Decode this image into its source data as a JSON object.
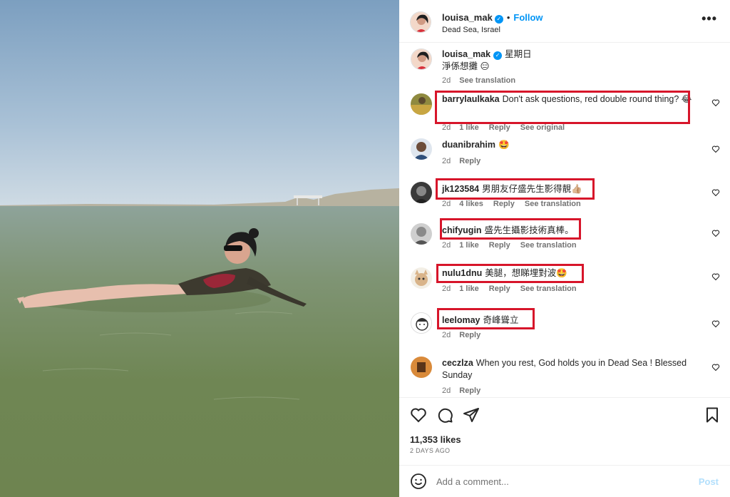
{
  "post": {
    "author": "louisa_mak",
    "follow_label": "Follow",
    "separator": "•",
    "location": "Dead Sea, Israel",
    "more_icon": "more-horizontal-icon",
    "caption": {
      "user": "louisa_mak",
      "day": "星期日",
      "text": "淨係想攤 😑",
      "time": "2d",
      "translate": "See translation"
    }
  },
  "comments": [
    {
      "user": "barrylaulkaka",
      "text": "Don't ask questions, red double round thing? 😂",
      "time": "2d",
      "likes": "1 like",
      "reply": "Reply",
      "extra": "See original",
      "highlighted": true
    },
    {
      "user": "duanibrahim",
      "text": "🤩",
      "time": "2d",
      "likes": "",
      "reply": "Reply",
      "extra": "",
      "highlighted": false
    },
    {
      "user": "jk123584",
      "text": "男朋友仔盛先生影得靚👍🏼",
      "time": "2d",
      "likes": "4 likes",
      "reply": "Reply",
      "extra": "See translation",
      "highlighted": true
    },
    {
      "user": "chifyugin",
      "text": "盛先生攝影技術真棒。",
      "time": "2d",
      "likes": "1 like",
      "reply": "Reply",
      "extra": "See translation",
      "highlighted": true
    },
    {
      "user": "nulu1dnu",
      "text": "美腿，想睇埋對波🤩",
      "time": "2d",
      "likes": "1 like",
      "reply": "Reply",
      "extra": "See translation",
      "highlighted": true
    },
    {
      "user": "leelomay",
      "text": "奇峰聳立",
      "time": "2d",
      "likes": "",
      "reply": "Reply",
      "extra": "",
      "highlighted": true
    },
    {
      "user": "ceczlza",
      "text": "When you rest, God holds you in Dead Sea ! Blessed Sunday",
      "time": "2d",
      "likes": "",
      "reply": "Reply",
      "extra": "",
      "highlighted": false
    }
  ],
  "actions": {
    "like_icon": "heart-icon",
    "comment_icon": "comment-icon",
    "share_icon": "send-icon",
    "save_icon": "bookmark-icon"
  },
  "stats": {
    "likes": "11,353 likes",
    "ago": "2 DAYS AGO"
  },
  "add_comment": {
    "placeholder": "Add a comment...",
    "post_label": "Post",
    "emoji_icon": "emoji-icon"
  },
  "colors": {
    "accent": "#0095f6",
    "highlight": "#d7152a",
    "muted": "#737373"
  }
}
